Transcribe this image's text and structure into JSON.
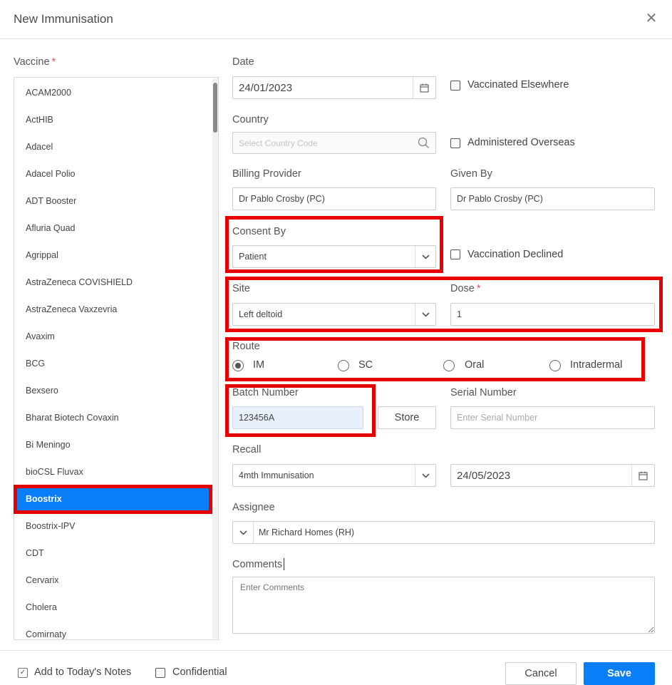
{
  "dialog": {
    "title": "New Immunisation"
  },
  "vaccine": {
    "label": "Vaccine",
    "required_mark": "*",
    "items": [
      "ACAM2000",
      "ActHIB",
      "Adacel",
      "Adacel Polio",
      "ADT Booster",
      "Afluria Quad",
      "Agrippal",
      "AstraZeneca COVISHIELD",
      "AstraZeneca Vaxzevria",
      "Avaxim",
      "BCG",
      "Bexsero",
      "Bharat Biotech Covaxin",
      "Bi Meningo",
      "bioCSL Fluvax",
      "Boostrix",
      "Boostrix-IPV",
      "CDT",
      "Cervarix",
      "Cholera",
      "Comirnaty"
    ],
    "selected": "Boostrix"
  },
  "date": {
    "label": "Date",
    "value": "24/01/2023"
  },
  "vaccinated_elsewhere": {
    "label": "Vaccinated Elsewhere",
    "checked": false
  },
  "country": {
    "label": "Country",
    "placeholder": "Select Country Code"
  },
  "administered_overseas": {
    "label": "Administered Overseas",
    "checked": false
  },
  "billing_provider": {
    "label": "Billing Provider",
    "value": "Dr Pablo Crosby (PC)"
  },
  "given_by": {
    "label": "Given By",
    "value": "Dr Pablo Crosby (PC)"
  },
  "consent_by": {
    "label": "Consent By",
    "value": "Patient"
  },
  "vaccination_declined": {
    "label": "Vaccination Declined",
    "checked": false
  },
  "site": {
    "label": "Site",
    "value": "Left deltoid"
  },
  "dose": {
    "label": "Dose",
    "required_mark": "*",
    "value": "1"
  },
  "route": {
    "label": "Route",
    "options": [
      "IM",
      "SC",
      "Oral",
      "Intradermal"
    ],
    "selected": "IM"
  },
  "batch_number": {
    "label": "Batch Number",
    "value": "123456A"
  },
  "store_button": {
    "label": "Store"
  },
  "serial_number": {
    "label": "Serial Number",
    "placeholder": "Enter Serial Number"
  },
  "recall": {
    "label": "Recall",
    "value": "4mth Immunisation",
    "date": "24/05/2023"
  },
  "assignee": {
    "label": "Assignee",
    "value": "Mr Richard Homes (RH)"
  },
  "comments": {
    "label": "Comments",
    "placeholder": "Enter Comments"
  },
  "footer": {
    "add_to_notes": {
      "label": "Add to Today's Notes",
      "checked": true
    },
    "confidential": {
      "label": "Confidential",
      "checked": false
    },
    "cancel_label": "Cancel",
    "save_label": "Save"
  },
  "colors": {
    "accent": "#0a7ef7",
    "highlight": "#e60000"
  }
}
